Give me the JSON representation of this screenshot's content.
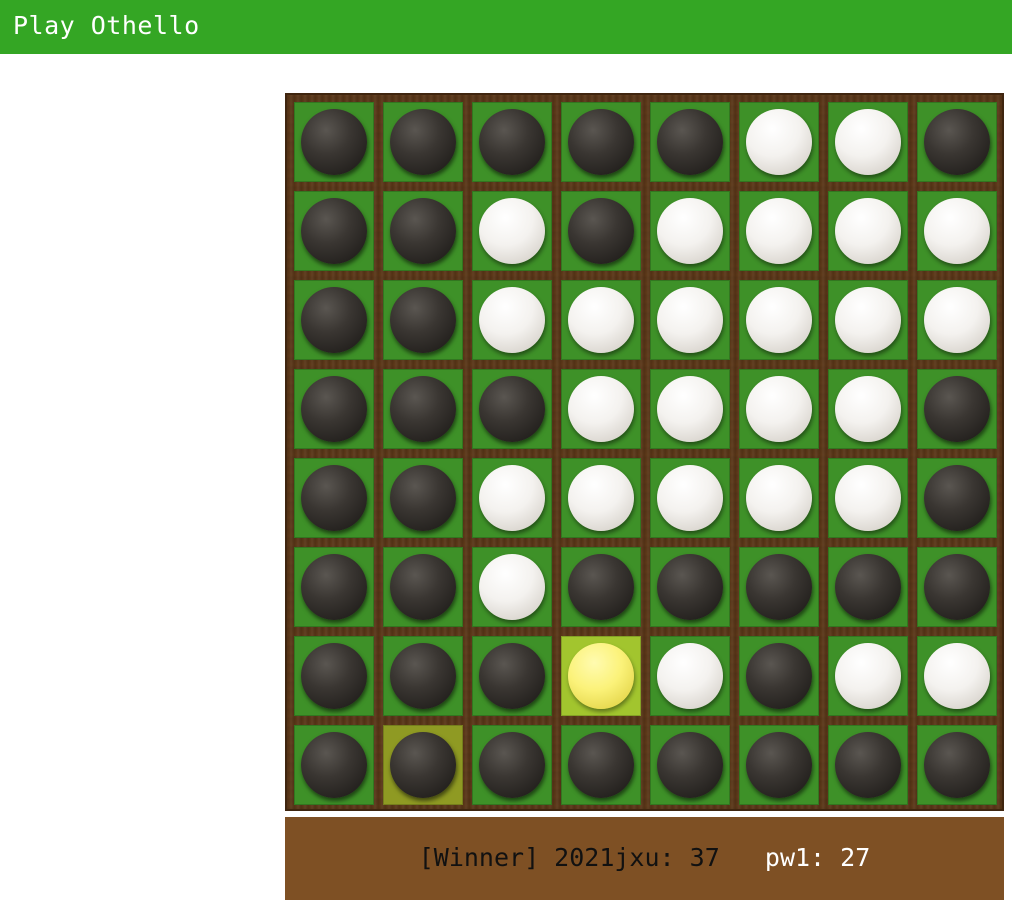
{
  "app": {
    "title": "Play Othello"
  },
  "board": {
    "size": 8,
    "rows": [
      [
        "black",
        "black",
        "black",
        "black",
        "black",
        "white",
        "white",
        "black"
      ],
      [
        "black",
        "black",
        "white",
        "black",
        "white",
        "white",
        "white",
        "white"
      ],
      [
        "black",
        "black",
        "white",
        "white",
        "white",
        "white",
        "white",
        "white"
      ],
      [
        "black",
        "black",
        "black",
        "white",
        "white",
        "white",
        "white",
        "black"
      ],
      [
        "black",
        "black",
        "white",
        "white",
        "white",
        "white",
        "white",
        "black"
      ],
      [
        "black",
        "black",
        "white",
        "black",
        "black",
        "black",
        "black",
        "black"
      ],
      [
        "black",
        "black",
        "black",
        "yellow",
        "white",
        "black",
        "white",
        "white"
      ],
      [
        "black",
        "black",
        "black",
        "black",
        "black",
        "black",
        "black",
        "black"
      ]
    ],
    "last_move": {
      "row": 6,
      "col": 3
    },
    "highlight": {
      "row": 7,
      "col": 1
    },
    "colors": {
      "cell": "#3e9128",
      "last_move_cell": "#a2c52e",
      "highlight_cell": "#8f9a23",
      "frame": "#5b3718"
    }
  },
  "status": {
    "player1_text": "[Winner] 2021jxu: 37",
    "separator": "   ",
    "player2_text": "pw1: 27",
    "background": "#7e5024"
  },
  "theme": {
    "accent": "#34a624"
  }
}
